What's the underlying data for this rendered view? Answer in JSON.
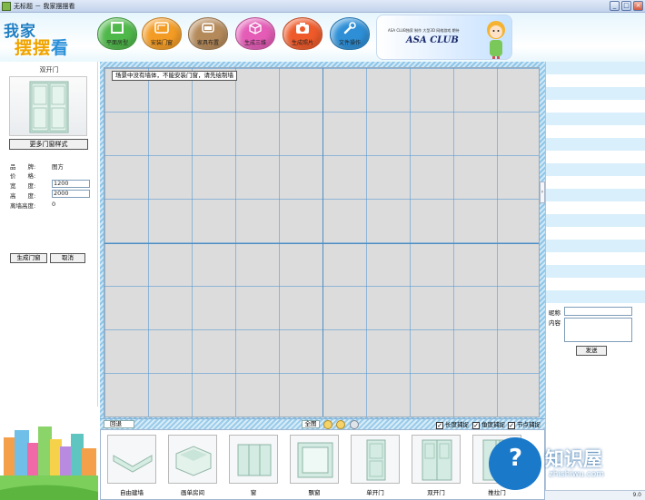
{
  "window": {
    "title": "无标题 － 我家摆摆看",
    "controls": [
      "_",
      "□",
      "×"
    ]
  },
  "header": {
    "logo_line1": "我家",
    "logo_line2a": "摆摆",
    "logo_line2b": "看",
    "tools": [
      {
        "label": "平面房型",
        "color": "#4fb84a",
        "icon": "square-icon"
      },
      {
        "label": "安装门窗",
        "color": "#f39c25",
        "icon": "frame-icon"
      },
      {
        "label": "家具布置",
        "color": "#b58a5a",
        "icon": "sofa-icon"
      },
      {
        "label": "生成三维",
        "color": "#e45cb6",
        "icon": "cube-icon"
      },
      {
        "label": "生成照片",
        "color": "#ee5a2a",
        "icon": "camera-icon"
      },
      {
        "label": "文件操作",
        "color": "#2e8fd6",
        "icon": "wrench-icon"
      }
    ],
    "banner": {
      "small_text": "ASA CLUB独家 制作 大型3D 网络游戏 期待",
      "big_text": "ASA CLUB"
    }
  },
  "left_panel": {
    "title": "双开门",
    "more_styles": "更多门窗样式",
    "props": [
      {
        "label": "品　　牌:",
        "value": "图方",
        "editable": false
      },
      {
        "label": "价　　格:",
        "value": "",
        "editable": false
      },
      {
        "label": "宽　　度:",
        "value": "1200",
        "editable": true
      },
      {
        "label": "高　　度:",
        "value": "2000",
        "editable": true
      },
      {
        "label": "离墙高度:",
        "value": "0",
        "editable": false
      }
    ],
    "generate_button": "生成门窗",
    "cancel_button": "取消"
  },
  "canvas": {
    "message": "场景中没有墙体，不能安装门窗，请先绘制墙",
    "collapse_glyph": "›"
  },
  "canvas_toolbar": {
    "back_label": "回退",
    "all_label": "全图",
    "checks": [
      {
        "label": "长度捕捉",
        "checked": true
      },
      {
        "label": "角度捕捉",
        "checked": true
      },
      {
        "label": "节点捕捉",
        "checked": true
      }
    ],
    "check_mark": "✓"
  },
  "components": [
    {
      "label": "自由建墙",
      "kind": "wall"
    },
    {
      "label": "画单房间",
      "kind": "room"
    },
    {
      "label": "窗",
      "kind": "window"
    },
    {
      "label": "飘窗",
      "kind": "bay-window"
    },
    {
      "label": "单开门",
      "kind": "single-door"
    },
    {
      "label": "双开门",
      "kind": "double-door"
    },
    {
      "label": "推拉门",
      "kind": "sliding-door"
    }
  ],
  "right_panel": {
    "nickname_label": "昵称",
    "content_label": "内容",
    "send_button": "发送"
  },
  "watermark": {
    "symbol": "?",
    "name": "知识屋",
    "url": "zhishiwu.com"
  },
  "status": {
    "corner_text": "9.0"
  }
}
